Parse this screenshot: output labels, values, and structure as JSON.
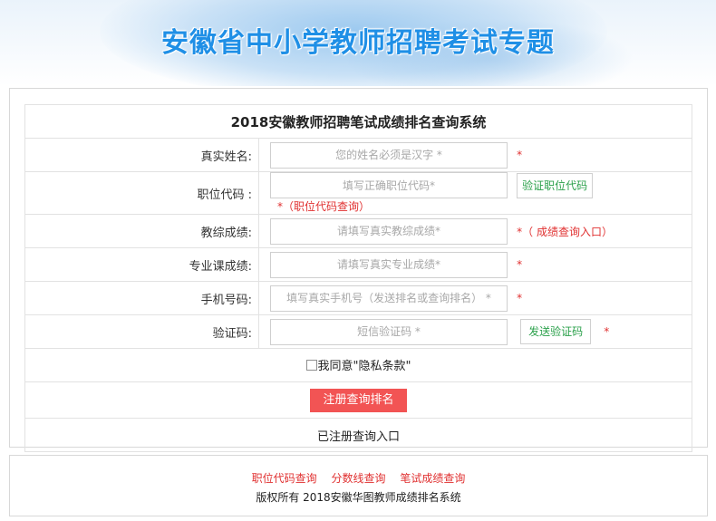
{
  "banner": {
    "title": "安徽省中小学教师招聘考试专题"
  },
  "form": {
    "title": "2018安徽教师招聘笔试成绩排名查询系统",
    "name": {
      "label": "真实姓名:",
      "placeholder": "您的姓名必须是汉字 *",
      "required": "*"
    },
    "position_code": {
      "label": "职位代码 :",
      "placeholder": "填写正确职位代码*",
      "verify_button": "验证职位代码",
      "hint": "*（职位代码查询）"
    },
    "comprehensive_score": {
      "label": "教综成绩:",
      "placeholder": "请填写真实教综成绩*",
      "hint": "*（ 成绩查询入口）"
    },
    "professional_score": {
      "label": "专业课成绩:",
      "placeholder": "请填写真实专业成绩*",
      "required": "*"
    },
    "phone": {
      "label": "手机号码:",
      "placeholder": "填写真实手机号（发送排名或查询排名） *",
      "required": "*"
    },
    "captcha": {
      "label": "验证码:",
      "placeholder": "短信验证码 *",
      "send_button": "发送验证码",
      "required": "*"
    },
    "agree": {
      "checked": false,
      "label": "我同意\"隐私条款\""
    },
    "submit_button": "注册查询排名",
    "login_link": "已注册查询入口"
  },
  "footer": {
    "links": [
      "职位代码查询",
      "分数线查询",
      "笔试成绩查询"
    ],
    "copyright": "版权所有 2018安徽华图教师成绩排名系统"
  },
  "colors": {
    "banner_title": "#1f8fe6",
    "required_star": "#e03030",
    "verify_button_text": "#2aa04a",
    "submit_button_bg": "#f25454"
  },
  "icons": {
    "agree_checkbox": "checkbox-unchecked-icon"
  }
}
